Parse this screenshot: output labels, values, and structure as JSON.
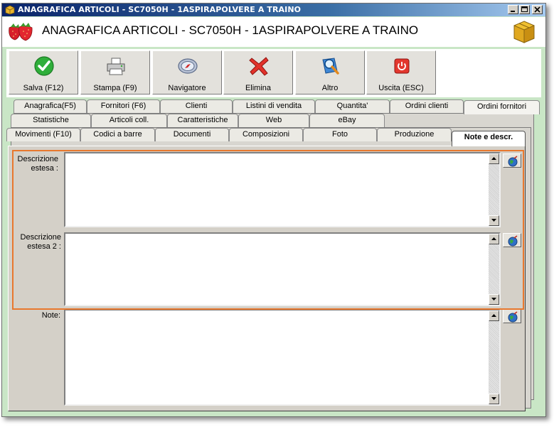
{
  "window": {
    "title": "ANAGRAFICA ARTICOLI - SC7050H - 1ASPIRAPOLVERE A TRAINO",
    "header_title": "ANAGRAFICA ARTICOLI - SC7050H - 1ASPIRAPOLVERE A TRAINO",
    "controls": [
      "minimize-icon",
      "maximize-icon",
      "close-icon"
    ]
  },
  "toolbar": {
    "save_label": "Salva (F12)",
    "print_label": "Stampa (F9)",
    "navigator_label": "Navigatore",
    "delete_label": "Elimina",
    "other_label": "Altro",
    "exit_label": "Uscita (ESC)"
  },
  "tabs": {
    "row1": [
      "Anagrafica(F5)",
      "Fornitori (F6)",
      "Clienti",
      "Listini di vendita",
      "Quantita'",
      "Ordini clienti",
      "Ordini fornitori"
    ],
    "row2": [
      "Statistiche",
      "Articoli coll.",
      "Caratteristiche",
      "Web",
      "eBay"
    ],
    "row3": [
      "Movimenti (F10)",
      "Codici a barre",
      "Documenti",
      "Composizioni",
      "Foto",
      "Produzione",
      "Note e descr."
    ],
    "active": "Note e descr."
  },
  "fields": {
    "desc_label": "Descrizione estesa :",
    "desc_value": "",
    "desc2_label": "Descrizione estesa 2 :",
    "desc2_value": "",
    "note_label": "Note:",
    "note_value": ""
  },
  "colors": {
    "window_bg": "#c9e6c6",
    "panel_bg": "#d4d0c8",
    "highlight": "#e8782e"
  }
}
